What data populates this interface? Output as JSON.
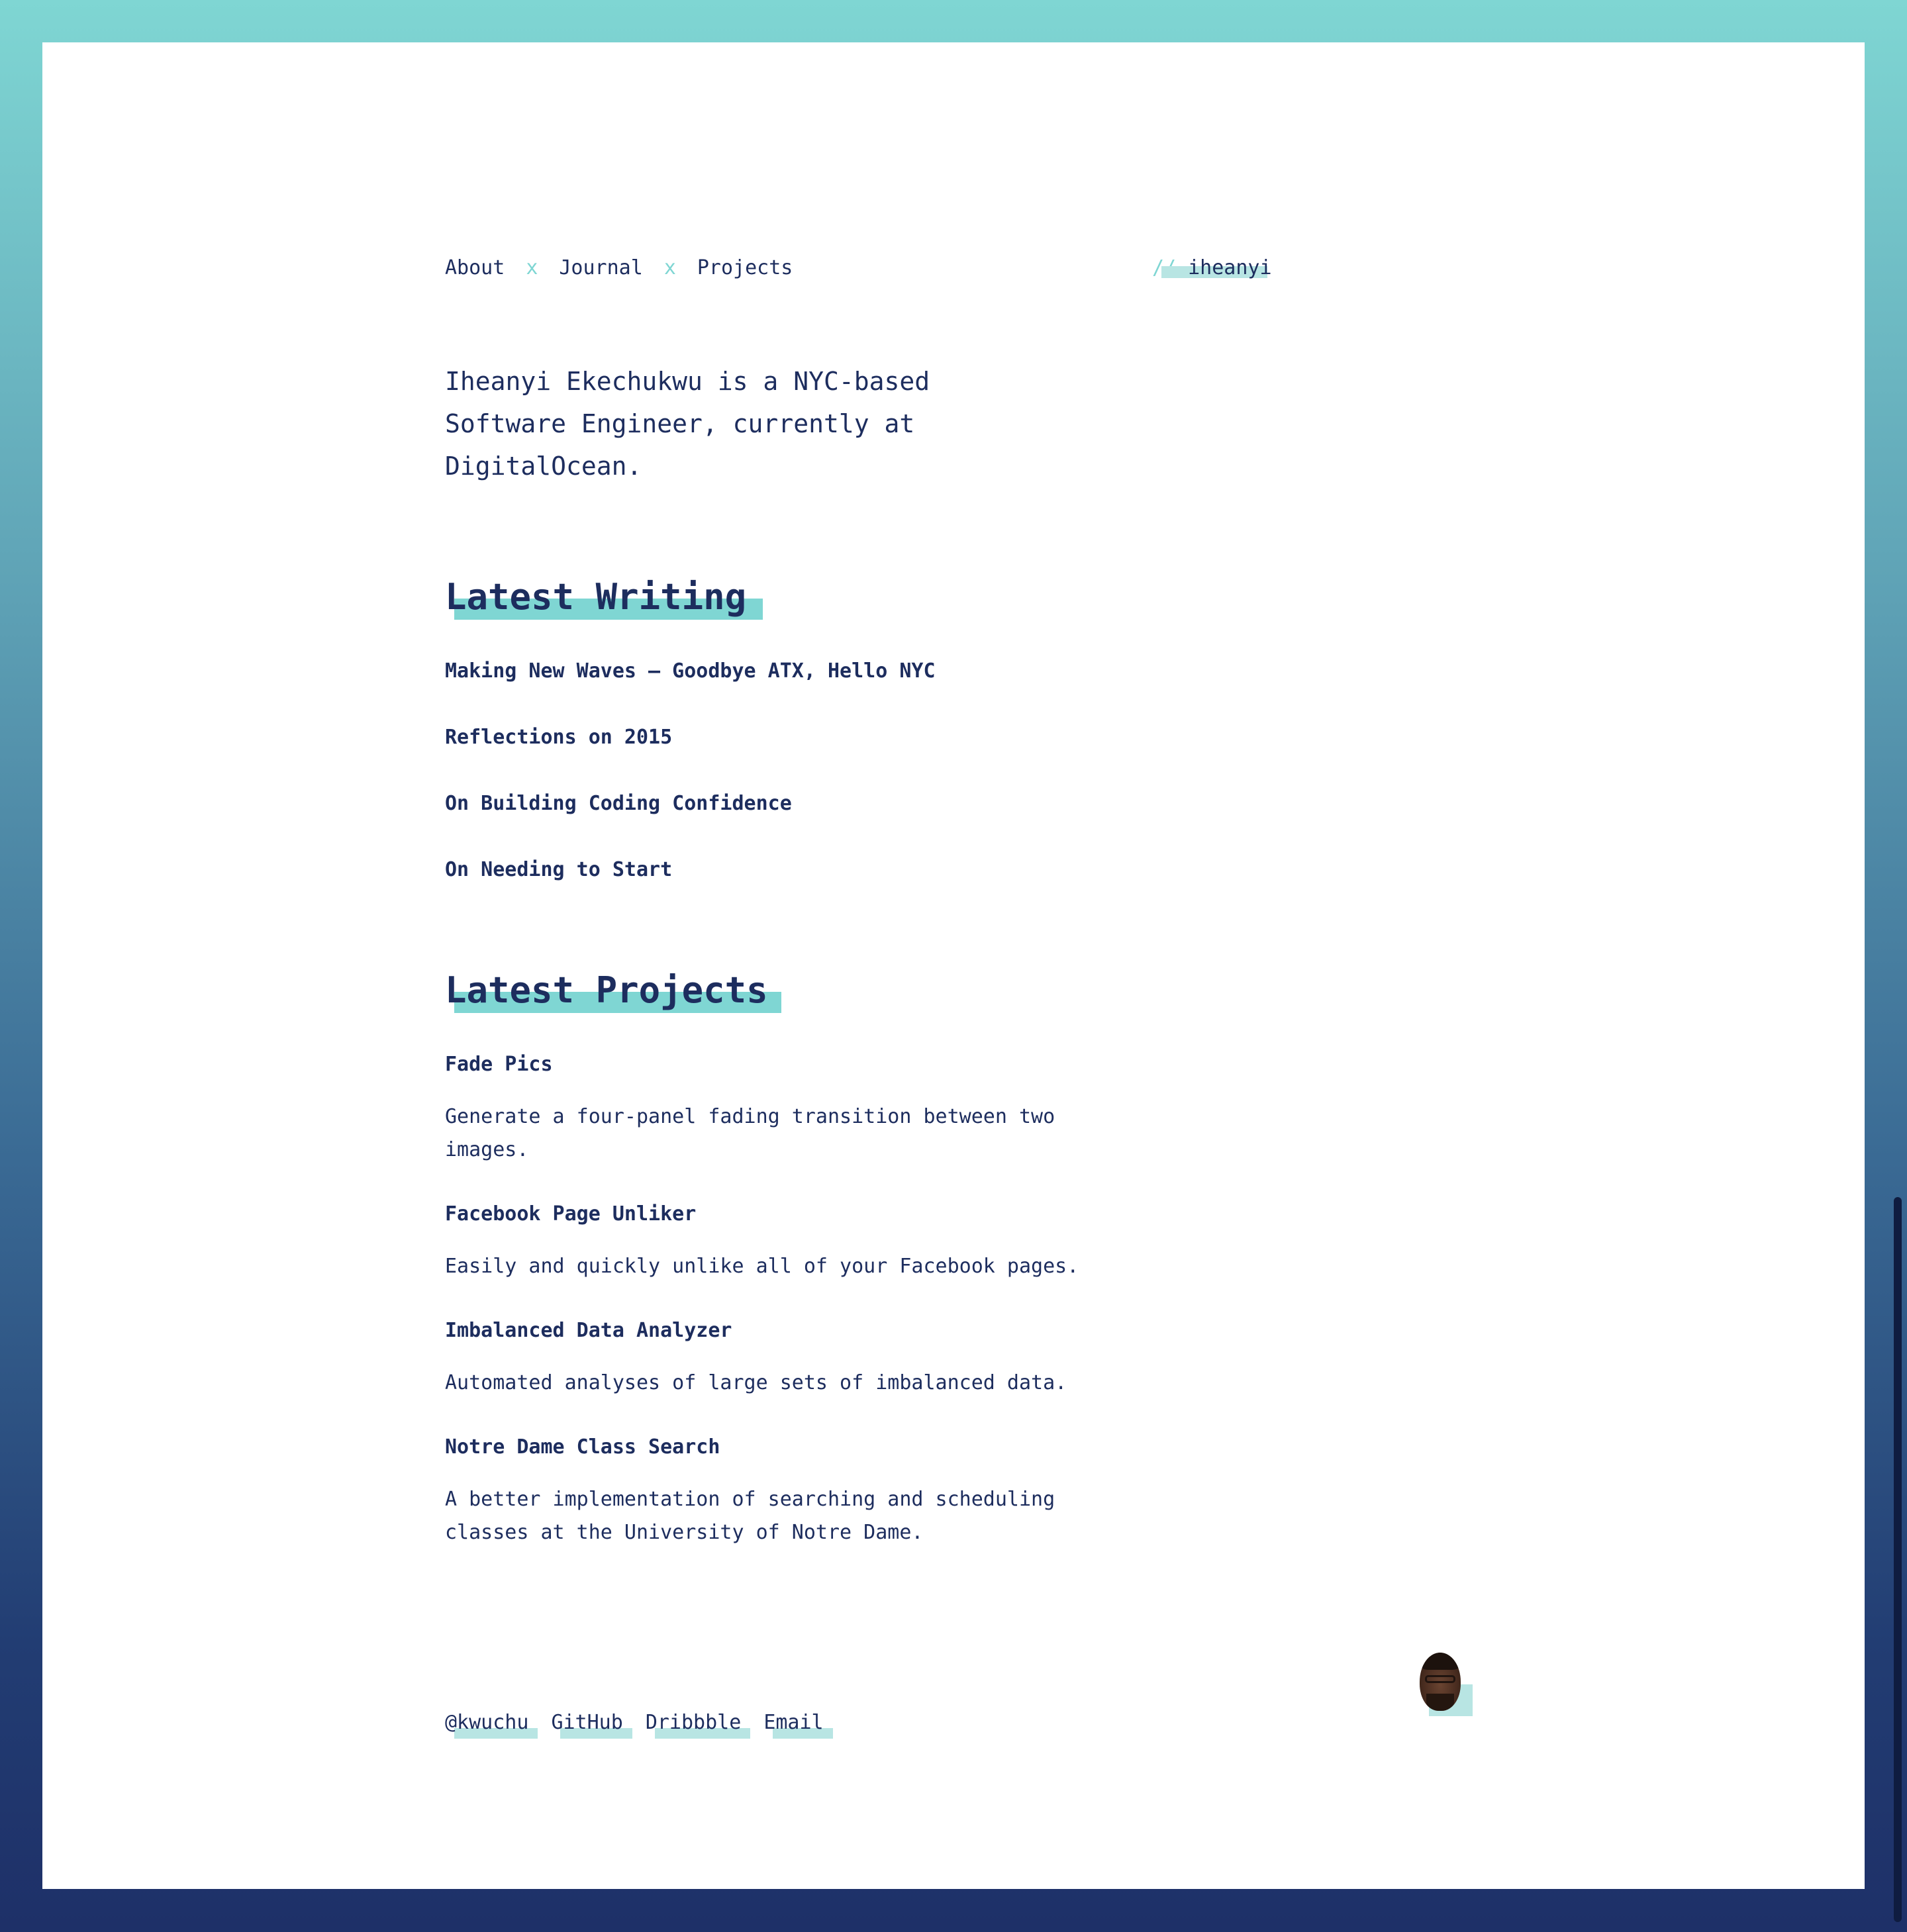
{
  "nav": {
    "items": [
      "About",
      "Journal",
      "Projects"
    ],
    "separator": "x"
  },
  "brand": {
    "prefix": "//",
    "name": "iheanyi"
  },
  "intro": "Iheanyi Ekechukwu is a NYC-based Software Engineer, currently at DigitalOcean.",
  "writing": {
    "title": "Latest Writing",
    "posts": [
      "Making New Waves — Goodbye ATX, Hello NYC",
      "Reflections on 2015",
      "On Building Coding Confidence",
      "On Needing to Start"
    ]
  },
  "projects": {
    "title": "Latest Projects",
    "items": [
      {
        "title": "Fade Pics",
        "description": "Generate a four-panel fading transition between two images."
      },
      {
        "title": "Facebook Page Unliker",
        "description": "Easily and quickly unlike all of your Facebook pages."
      },
      {
        "title": "Imbalanced Data Analyzer",
        "description": "Automated analyses of large sets of imbalanced data."
      },
      {
        "title": "Notre Dame Class Search",
        "description": "A better implementation of searching and scheduling classes at the University of Notre Dame."
      }
    ]
  },
  "footer": {
    "links": [
      "@kwuchu",
      "GitHub",
      "Dribbble",
      "Email"
    ]
  },
  "colors": {
    "accent": "#7fd6d3",
    "accent_light": "#b8e5e3",
    "text": "#1d2d5e",
    "gradient_top": "#7fd6d3",
    "gradient_bottom": "#1e3068"
  }
}
